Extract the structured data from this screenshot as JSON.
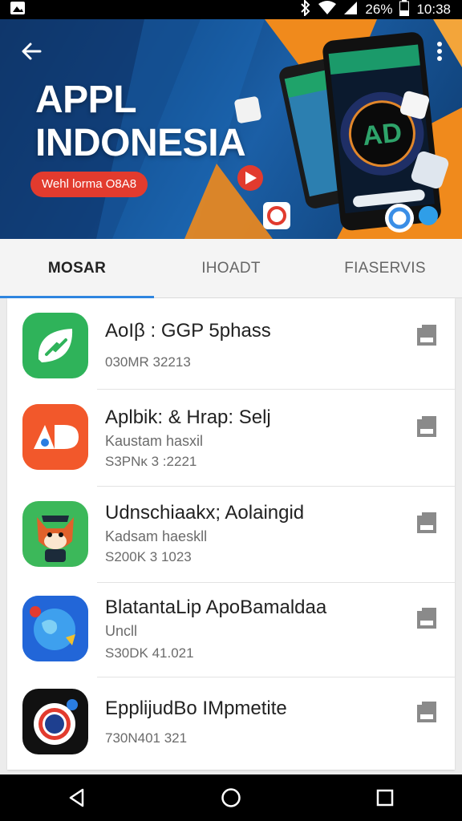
{
  "status_bar": {
    "battery_percent": "26%",
    "time": "10:38",
    "icons": [
      "gallery-icon",
      "bluetooth-icon",
      "wifi-icon",
      "signal-icon",
      "battery-icon"
    ]
  },
  "hero": {
    "title_line1": "APPL",
    "title_line2": "INDONESIA",
    "pill_text": "Wehl lorma O8A8",
    "phone_logo": "AD",
    "colors": {
      "background": "#134b8a",
      "accent_orange": "#f08a1c",
      "pill": "#e23b2e"
    }
  },
  "tabs": [
    {
      "label": "MOSAR",
      "active": true
    },
    {
      "label": "IHOADT",
      "active": false
    },
    {
      "label": "FIASERVIS",
      "active": false
    }
  ],
  "apps": [
    {
      "name": "AoIβ : GGP 5phass",
      "subtitle": "",
      "meta": "030MR 32213",
      "icon": "green-leaf-icon",
      "icon_color": "#2fb35a"
    },
    {
      "name": "Aplbik: & Hrap: Selj",
      "subtitle": "Kaustam hasxil",
      "meta": "S3ΡΝκ 3 :2221",
      "icon": "ad-logo-icon",
      "icon_color": "#f2582b"
    },
    {
      "name": "Udnschiaakx; Aolaingid",
      "subtitle": "Kadsam haeskll",
      "meta": "S200K 3 1023",
      "icon": "fox-mascot-icon",
      "icon_color": "#3cb85a"
    },
    {
      "name": "BlatantaLip ApoBamaldaa",
      "subtitle": "Uncll",
      "meta": "S30DK 41.021",
      "icon": "globe-icon",
      "icon_color": "#1f6fe0"
    },
    {
      "name": "EpplijudBo IMpmetite",
      "subtitle": "",
      "meta": "730Ν401 321",
      "icon": "camera-lens-icon",
      "icon_color": "#111111"
    }
  ],
  "nav_bar": {
    "icons": [
      "back-triangle-icon",
      "home-circle-icon",
      "recents-square-icon"
    ]
  }
}
